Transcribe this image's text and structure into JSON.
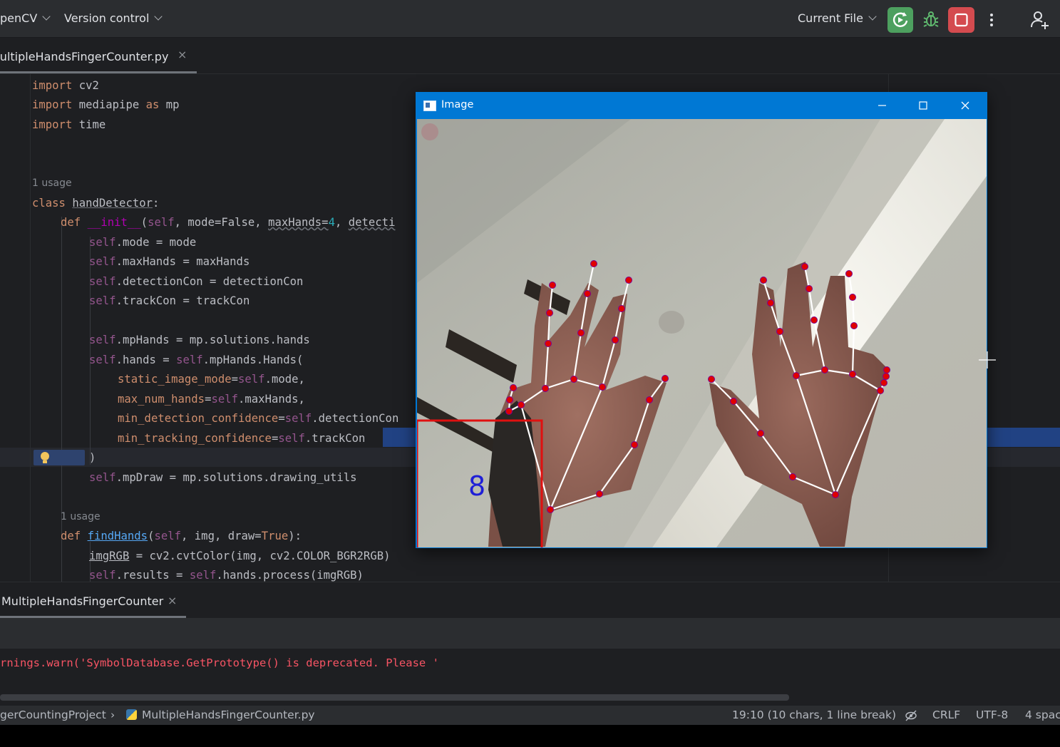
{
  "titlebar": {
    "project_menu": "penCV",
    "vcs_menu": "Version control",
    "run_config": "Current File"
  },
  "editor_tab": {
    "filename": "MultipleHandsFingerCounter.py",
    "close": "×"
  },
  "code": {
    "l1": {
      "kw": "import",
      "rest": " cv2"
    },
    "l2": {
      "kw": "import",
      "mid": " mediapipe ",
      "kw2": "as",
      "rest": " mp"
    },
    "l3": {
      "kw": "import",
      "rest": " time"
    },
    "usage1": "1 usage",
    "l4": {
      "kw": "class",
      "name": "handDetector",
      "rest": ":"
    },
    "l5": {
      "kw": "def",
      "name": "__init__",
      "open": "(",
      "self": "self",
      "rest": ", mode=False, ",
      "p1": "maxHands=",
      "n1": "4",
      "rest2": ", ",
      "p2": "detecti"
    },
    "l6": {
      "self": "self",
      "rest": ".mode = mode"
    },
    "l7": {
      "self": "self",
      "rest": ".maxHands = maxHands"
    },
    "l8": {
      "self": "self",
      "rest": ".detectionCon = detectionCon"
    },
    "l9": {
      "self": "self",
      "rest": ".trackCon = trackCon"
    },
    "l10": {
      "self": "self",
      "rest": ".mpHands = mp.solutions.hands"
    },
    "l11": {
      "self": "self",
      "mid": ".hands = ",
      "self2": "self",
      "rest": ".mpHands.Hands("
    },
    "l12": {
      "param": "static_image_mode",
      "eq": "=",
      "self": "self",
      "rest": ".mode,"
    },
    "l13": {
      "param": "max_num_hands",
      "eq": "=",
      "self": "self",
      "rest": ".maxHands,"
    },
    "l14": {
      "param": "min_detection_confidence",
      "eq": "=",
      "self": "self",
      "rest": ".detectionCon"
    },
    "l15": {
      "param": "min_tracking_confidence",
      "eq": "=",
      "self": "self",
      "rest": ".trackCon"
    },
    "l16": {
      "rest": ")"
    },
    "l17": {
      "self": "self",
      "rest": ".mpDraw = mp.solutions.drawing_utils"
    },
    "usage2": "1 usage",
    "l18": {
      "kw": "def",
      "name": "findHands",
      "open": "(",
      "self": "self",
      "rest": ", img, draw=",
      "kw2": "True",
      "end": "):"
    },
    "l19": {
      "var": "imgRGB",
      "rest": " = cv2.cvtColor(img, cv2.COLOR_BGR2RGB)"
    },
    "l20": {
      "self": "self",
      "mid": ".results = ",
      "self2": "self",
      "rest": ".hands.process(imgRGB)"
    }
  },
  "image_window": {
    "title": "Image",
    "finger_count": "8",
    "count_color": "#1f1fd6",
    "box_color": "#e01010",
    "landmark_color": "#e00000",
    "connection_color": "#ffffff"
  },
  "run_panel": {
    "tab": "MultipleHandsFingerCounter",
    "close": "×",
    "console": "rnings.warn('SymbolDatabase.GetPrototype() is deprecated. Please '"
  },
  "statusbar": {
    "project": "gerCountingProject",
    "separator": "›",
    "file": "MultipleHandsFingerCounter.py",
    "position": "19:10 (10 chars, 1 line break)",
    "line_ending": "CRLF",
    "encoding": "UTF-8",
    "indent": "4 spac"
  },
  "icons": [
    "chevron-down-icon",
    "run-icon",
    "debug-icon",
    "stop-icon",
    "more-icon",
    "add-user-icon",
    "close-icon",
    "lightbulb-icon",
    "python-file-icon",
    "no-inspections-icon",
    "window-app-icon",
    "minimize-icon",
    "maximize-icon",
    "close-window-icon"
  ],
  "colors": {
    "run": "#4da05f",
    "stop": "#d44b4f",
    "titlebar_blue": "#0078d4",
    "error_text": "#f75464"
  }
}
